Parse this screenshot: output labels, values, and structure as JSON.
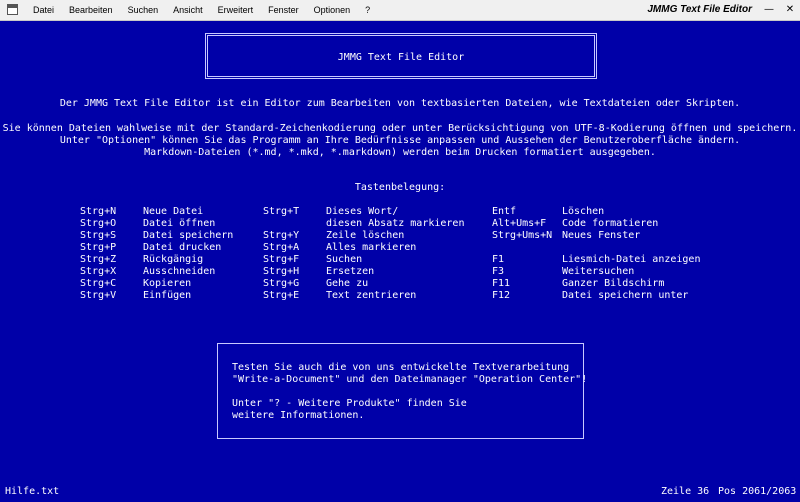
{
  "menubar": {
    "items": [
      "Datei",
      "Bearbeiten",
      "Suchen",
      "Ansicht",
      "Erweitert",
      "Fenster",
      "Optionen",
      "?"
    ],
    "window_title": "JMMG Text File Editor",
    "minimize_glyph": "—",
    "close_glyph": "✕"
  },
  "title_box": {
    "text": "JMMG Text File Editor"
  },
  "intro": {
    "line1": "Der JMMG Text File Editor ist ein Editor zum Bearbeiten von textbasierten Dateien, wie Textdateien oder Skripten.",
    "line2": "Sie können Dateien wahlweise mit der Standard-Zeichenkodierung oder unter Berücksichtigung von UTF-8-Kodierung öffnen und speichern.",
    "line3": "Unter \"Optionen\" können Sie das Programm an Ihre Bedürfnisse anpassen und Aussehen der Benutzeroberfläche ändern.",
    "line4": "Markdown-Dateien (*.md, *.mkd, *.markdown) werden beim Drucken formatiert ausgegeben."
  },
  "shortcuts_heading": "Tastenbelegung:",
  "shortcuts": {
    "col1": [
      {
        "key": "Strg+N",
        "label": "Neue Datei"
      },
      {
        "key": "Strg+O",
        "label": "Datei öffnen"
      },
      {
        "key": "Strg+S",
        "label": "Datei speichern"
      },
      {
        "key": "Strg+P",
        "label": "Datei drucken"
      },
      {
        "key": "Strg+Z",
        "label": "Rückgängig"
      },
      {
        "key": "Strg+X",
        "label": "Ausschneiden"
      },
      {
        "key": "Strg+C",
        "label": "Kopieren"
      },
      {
        "key": "Strg+V",
        "label": "Einfügen"
      }
    ],
    "col2": [
      {
        "key": "Strg+T",
        "label": "Dieses Wort/"
      },
      {
        "key": "",
        "label": "diesen Absatz markieren"
      },
      {
        "key": "Strg+Y",
        "label": "Zeile löschen"
      },
      {
        "key": "Strg+A",
        "label": "Alles markieren"
      },
      {
        "key": "Strg+F",
        "label": "Suchen"
      },
      {
        "key": "Strg+H",
        "label": "Ersetzen"
      },
      {
        "key": "Strg+G",
        "label": "Gehe zu"
      },
      {
        "key": "Strg+E",
        "label": "Text zentrieren"
      }
    ],
    "col3": [
      {
        "key": "Entf",
        "label": "Löschen"
      },
      {
        "key": "Alt+Ums+F",
        "label": "Code formatieren"
      },
      {
        "key": "Strg+Ums+N",
        "label": "Neues Fenster"
      },
      {
        "key": "",
        "label": ""
      },
      {
        "key": "F1",
        "label": "Liesmich-Datei anzeigen"
      },
      {
        "key": "F3",
        "label": "Weitersuchen"
      },
      {
        "key": "F11",
        "label": "Ganzer Bildschirm"
      },
      {
        "key": "F12",
        "label": "Datei speichern unter"
      }
    ]
  },
  "info_box": {
    "line1": "Testen Sie auch die von uns entwickelte Textverarbeitung",
    "line2": "\"Write-a-Document\" und den Dateimanager \"Operation Center\"!",
    "line3": "Unter \"? - Weitere Produkte\" finden Sie",
    "line4": "weitere Informationen."
  },
  "statusbar": {
    "filename": "Hilfe.txt",
    "line": "Zeile 36",
    "pos": "Pos 2061/2063"
  },
  "colors": {
    "background": "#0000a8",
    "text": "#ffffff",
    "menubar": "#f0f0f0"
  }
}
